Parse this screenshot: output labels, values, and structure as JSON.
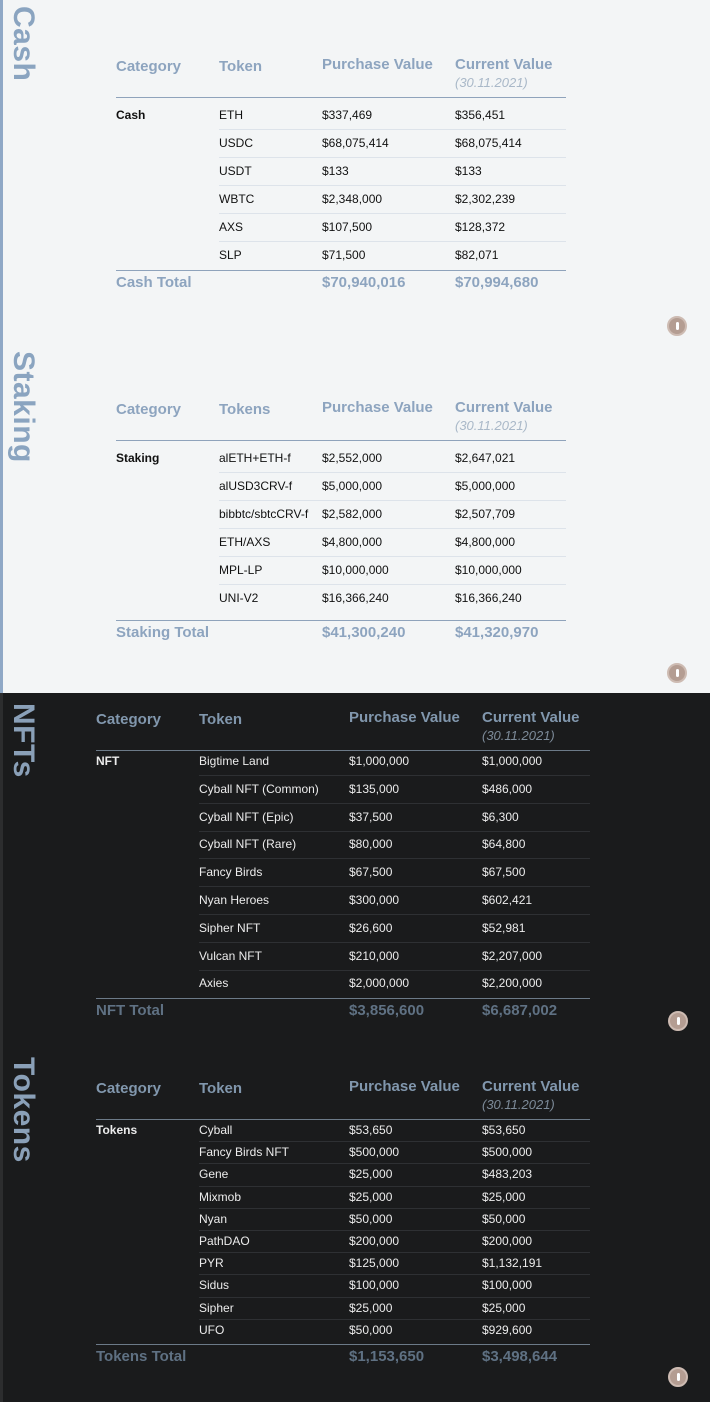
{
  "sections": {
    "cash": {
      "title": "Cash",
      "headers": {
        "category": "Category",
        "token": "Token",
        "purchase": "Purchase Value",
        "current": "Current Value",
        "date": "(30.11.2021)"
      },
      "category": "Cash",
      "rows": [
        {
          "token": "ETH",
          "purchase": "$337,469",
          "current": "$356,451"
        },
        {
          "token": "USDC",
          "purchase": "$68,075,414",
          "current": "$68,075,414"
        },
        {
          "token": "USDT",
          "purchase": "$133",
          "current": "$133"
        },
        {
          "token": "WBTC",
          "purchase": "$2,348,000",
          "current": "$2,302,239"
        },
        {
          "token": "AXS",
          "purchase": "$107,500",
          "current": "$128,372"
        },
        {
          "token": "SLP",
          "purchase": "$71,500",
          "current": "$82,071"
        }
      ],
      "total": {
        "label": "Cash Total",
        "purchase": "$70,940,016",
        "current": "$70,994,680"
      }
    },
    "staking": {
      "title": "Staking",
      "headers": {
        "category": "Category",
        "token": "Tokens",
        "purchase": "Purchase Value",
        "current": "Current Value",
        "date": "(30.11.2021)"
      },
      "category": "Staking",
      "rows": [
        {
          "token": "alETH+ETH-f",
          "purchase": "$2,552,000",
          "current": "$2,647,021"
        },
        {
          "token": "alUSD3CRV-f",
          "purchase": "$5,000,000",
          "current": "$5,000,000"
        },
        {
          "token": "bibbtc/sbtcCRV-f",
          "purchase": "$2,582,000",
          "current": "$2,507,709"
        },
        {
          "token": "ETH/AXS",
          "purchase": "$4,800,000",
          "current": "$4,800,000"
        },
        {
          "token": "MPL-LP",
          "purchase": "$10,000,000",
          "current": "$10,000,000"
        },
        {
          "token": "UNI-V2",
          "purchase": "$16,366,240",
          "current": "$16,366,240"
        }
      ],
      "total": {
        "label": "Staking Total",
        "purchase": "$41,300,240",
        "current": "$41,320,970"
      }
    },
    "nfts": {
      "title": "NFTs",
      "headers": {
        "category": "Category",
        "token": "Token",
        "purchase": "Purchase Value",
        "current": "Current Value",
        "date": "(30.11.2021)"
      },
      "category": "NFT",
      "rows": [
        {
          "token": "Bigtime Land",
          "purchase": "$1,000,000",
          "current": "$1,000,000"
        },
        {
          "token": "Cyball NFT (Common)",
          "purchase": "$135,000",
          "current": "$486,000"
        },
        {
          "token": "Cyball NFT (Epic)",
          "purchase": "$37,500",
          "current": "$6,300"
        },
        {
          "token": "Cyball NFT (Rare)",
          "purchase": "$80,000",
          "current": "$64,800"
        },
        {
          "token": "Fancy Birds",
          "purchase": "$67,500",
          "current": "$67,500"
        },
        {
          "token": "Nyan Heroes",
          "purchase": "$300,000",
          "current": "$602,421"
        },
        {
          "token": "Sipher NFT",
          "purchase": "$26,600",
          "current": "$52,981"
        },
        {
          "token": "Vulcan NFT",
          "purchase": "$210,000",
          "current": "$2,207,000"
        },
        {
          "token": "Axies",
          "purchase": "$2,000,000",
          "current": "$2,200,000"
        }
      ],
      "total": {
        "label": "NFT Total",
        "purchase": "$3,856,600",
        "current": "$6,687,002"
      }
    },
    "tokens": {
      "title": "Tokens",
      "headers": {
        "category": "Category",
        "token": "Token",
        "purchase": "Purchase Value",
        "current": "Current Value",
        "date": "(30.11.2021)"
      },
      "category": "Tokens",
      "rows": [
        {
          "token": "Cyball",
          "purchase": "$53,650",
          "current": "$53,650"
        },
        {
          "token": "Fancy Birds NFT",
          "purchase": "$500,000",
          "current": "$500,000"
        },
        {
          "token": "Gene",
          "purchase": "$25,000",
          "current": "$483,203"
        },
        {
          "token": "Mixmob",
          "purchase": "$25,000",
          "current": "$25,000"
        },
        {
          "token": "Nyan",
          "purchase": "$50,000",
          "current": "$50,000"
        },
        {
          "token": "PathDAO",
          "purchase": "$200,000",
          "current": "$200,000"
        },
        {
          "token": "PYR",
          "purchase": "$125,000",
          "current": "$1,132,191"
        },
        {
          "token": "Sidus",
          "purchase": "$100,000",
          "current": "$100,000"
        },
        {
          "token": "Sipher",
          "purchase": "$25,000",
          "current": "$25,000"
        },
        {
          "token": "UFO",
          "purchase": "$50,000",
          "current": "$929,600"
        }
      ],
      "total": {
        "label": "Tokens Total",
        "purchase": "$1,153,650",
        "current": "$3,498,644"
      }
    }
  }
}
